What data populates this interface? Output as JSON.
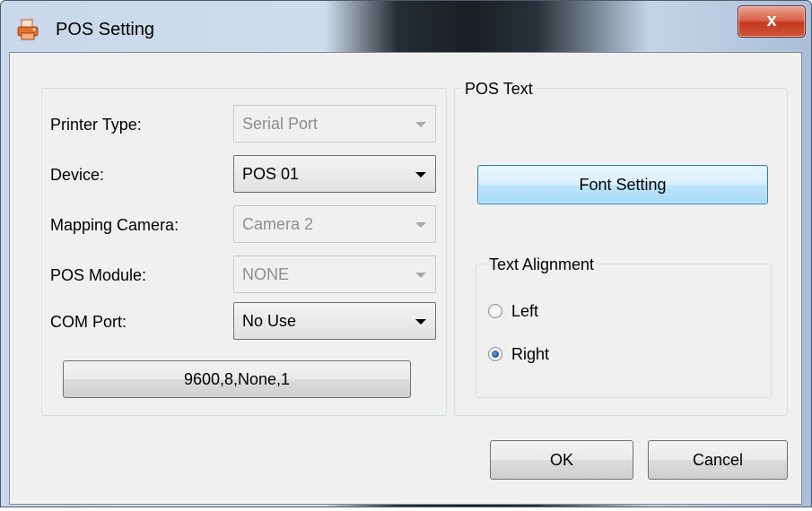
{
  "window": {
    "title": "POS Setting",
    "close_label": "x"
  },
  "left_group": {
    "fields": [
      {
        "label": "Printer Type:",
        "value": "Serial Port",
        "enabled": false
      },
      {
        "label": "Device:",
        "value": "POS 01",
        "enabled": true
      },
      {
        "label": "Mapping Camera:",
        "value": "Camera 2",
        "enabled": false
      },
      {
        "label": "POS Module:",
        "value": "NONE",
        "enabled": false
      },
      {
        "label": "COM Port:",
        "value": "No Use",
        "enabled": true
      }
    ],
    "serial_settings_button": "9600,8,None,1"
  },
  "right_group": {
    "title": "POS Text",
    "font_setting_button": "Font Setting",
    "alignment": {
      "title": "Text Alignment",
      "options": [
        {
          "label": "Left",
          "checked": false
        },
        {
          "label": "Right",
          "checked": true
        }
      ]
    }
  },
  "footer": {
    "ok_label": "OK",
    "cancel_label": "Cancel"
  }
}
